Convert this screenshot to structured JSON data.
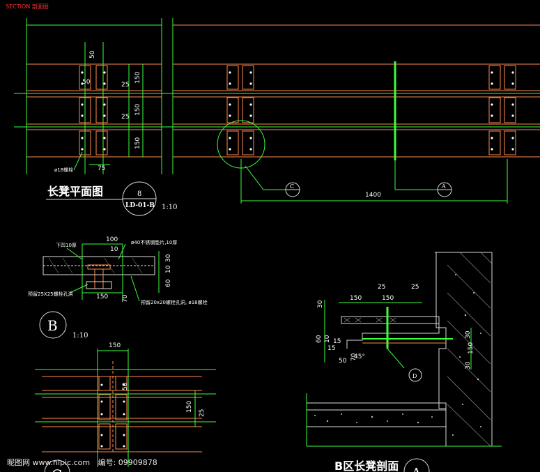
{
  "header": {
    "label": "SECTION 剖面图"
  },
  "plan": {
    "title": "长凳平面图",
    "callout_number": "8",
    "callout_ref": "LD-01-B",
    "scale": "1:10",
    "bolt_note": "ø18螺栓",
    "dims": {
      "top": "50",
      "gap": "50",
      "d150a": "150",
      "d25a": "25",
      "d150b": "150",
      "d25b": "25",
      "d150c": "150",
      "bottom": "75",
      "length": "1400"
    },
    "section_marks": {
      "left": "C",
      "right": "A"
    }
  },
  "detail_b": {
    "label": "B",
    "scale": "1:10",
    "note_top_left": "下凹10厚",
    "note_top_right": "ø40不锈钢垫片,10厚",
    "note_bottom_left": "预留25X25螺栓孔洞",
    "note_bottom_right": "预留20x20螺栓孔洞, ø18螺栓",
    "dims": {
      "d100": "100",
      "d10": "10",
      "d150": "150",
      "d30": "30",
      "d10v": "10",
      "d60": "60",
      "d70": "70"
    }
  },
  "detail_c": {
    "label": "C",
    "dims": {
      "d150": "150",
      "d50": "50",
      "d150v": "150",
      "d25": "25"
    }
  },
  "section_a": {
    "title": "B区长凳剖面",
    "label": "A",
    "mark": "D",
    "dims": {
      "d150a": "150",
      "d25a": "25",
      "d150b": "150",
      "d25b": "25",
      "d30": "30",
      "d60": "60",
      "d10": "10",
      "d15": "15",
      "d15b": "15",
      "d50": "50",
      "d45": "45°",
      "d30r": "30",
      "d150r": "150",
      "d30r2": "30",
      "d70": "70"
    }
  },
  "watermark": {
    "site": "昵图网 www.nipic.com",
    "id_label": "编号",
    "id": "09909878"
  },
  "colors": {
    "frame": "#3cff3c",
    "member": "#ff8a4a",
    "text": "#ffffff",
    "hatch": "#dcdcdc"
  }
}
